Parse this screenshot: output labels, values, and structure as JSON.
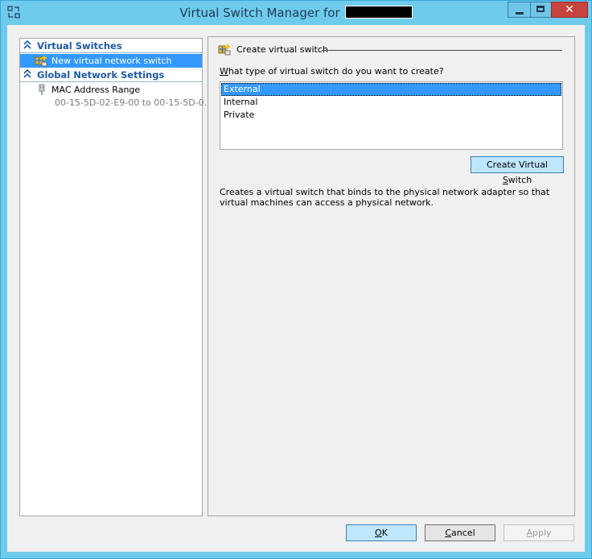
{
  "window": {
    "title": "Virtual Switch Manager for",
    "title_redacted": true
  },
  "titlebar_buttons": {
    "close_glyph": "✕"
  },
  "left_pane": {
    "sections": [
      {
        "header": "Virtual Switches",
        "items": [
          {
            "label": "New virtual network switch",
            "selected": true,
            "icon": "virtual-switch-add-icon"
          }
        ]
      },
      {
        "header": "Global Network Settings",
        "items": [
          {
            "label": "MAC Address Range",
            "sub": "00-15-5D-02-E9-00 to 00-15-5D-0...",
            "icon": "network-adapter-icon"
          }
        ]
      }
    ]
  },
  "right_pane": {
    "group_title": "Create virtual switch",
    "question_prefix": "W",
    "question_rest": "hat type of virtual switch do you want to create?",
    "switch_types": [
      {
        "label": "External",
        "selected": true
      },
      {
        "label": "Internal",
        "selected": false
      },
      {
        "label": "Private",
        "selected": false
      }
    ],
    "create_button_pre": "Create Virtual ",
    "create_button_key": "S",
    "create_button_post": "witch",
    "description": "Creates a virtual switch that binds to the physical network adapter so that virtual machines can access a physical network."
  },
  "footer": {
    "ok_key": "O",
    "ok_rest": "K",
    "cancel_key": "C",
    "cancel_rest": "ancel",
    "apply_key": "A",
    "apply_rest": "pply",
    "apply_enabled": false
  },
  "colors": {
    "titlebar": "#6fcbec",
    "selection": "#3399ff",
    "section_header": "#1e5aa0",
    "close_button": "#c7443e"
  }
}
